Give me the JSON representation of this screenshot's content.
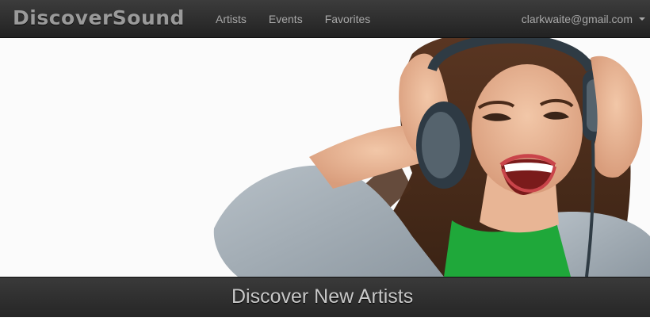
{
  "navbar": {
    "brand": "DiscoverSound",
    "links": [
      {
        "label": "Artists"
      },
      {
        "label": "Events"
      },
      {
        "label": "Favorites"
      }
    ],
    "user_email": "clarkwaite@gmail.com"
  },
  "hero": {
    "image": "woman-with-headphones-photo"
  },
  "banner": {
    "title": "Discover New Artists"
  },
  "colors": {
    "navbar_bg": "#2e2e2e",
    "nav_text": "#a8a8a8",
    "sweater": "#a9b3bb",
    "shirt": "#1fa83a",
    "hair": "#4a2b1a"
  }
}
